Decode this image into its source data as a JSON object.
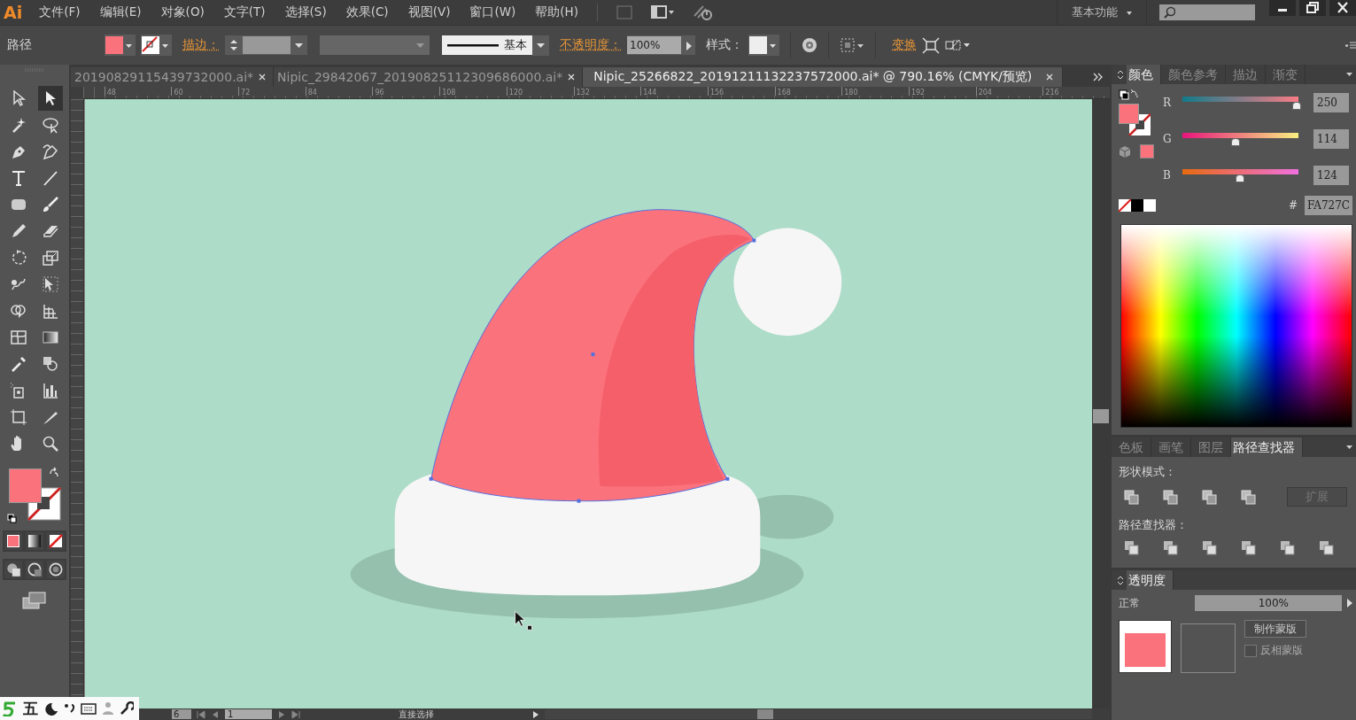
{
  "menu_bar": {
    "logo": "Ai",
    "items": [
      "文件(F)",
      "编辑(E)",
      "对象(O)",
      "文字(T)",
      "选择(S)",
      "效果(C)",
      "视图(V)",
      "窗口(W)",
      "帮助(H)"
    ],
    "workspace": "基本功能"
  },
  "control_bar": {
    "selection": "路径",
    "stroke_label": "描边：",
    "stroke_profile": "基本",
    "opacity_label": "不透明度：",
    "opacity": "100%",
    "style_label": "样式：",
    "transform": "变换"
  },
  "document_tabs": [
    {
      "title": "20190829115439732000.ai*",
      "selected": false
    },
    {
      "title": "Nipic_29842067_20190825112309686000.ai*",
      "selected": false
    },
    {
      "title": "Nipic_25266822_20191211132237572000.ai* @ 790.16% (CMYK/预览)",
      "selected": true
    }
  ],
  "ruler": {
    "ticks": [
      "48",
      "60",
      "72",
      "84",
      "96",
      "108",
      "120",
      "132",
      "144",
      "156",
      "168",
      "180",
      "192",
      "204",
      "216"
    ]
  },
  "tools": [
    {
      "selected": false
    },
    {
      "selected": true
    },
    {
      "selected": false
    },
    {
      "selected": false
    },
    {
      "selected": false
    },
    {
      "selected": false
    },
    {
      "selected": false
    },
    {
      "selected": false
    },
    {
      "selected": false
    },
    {
      "selected": false
    },
    {
      "selected": false
    },
    {
      "selected": false
    },
    {
      "selected": false
    },
    {
      "selected": false
    },
    {
      "selected": false
    },
    {
      "selected": false
    },
    {
      "selected": false
    },
    {
      "selected": false
    },
    {
      "selected": false
    },
    {
      "selected": false
    },
    {
      "selected": false
    },
    {
      "selected": false
    },
    {
      "selected": false
    },
    {
      "selected": false
    },
    {
      "selected": false
    },
    {
      "selected": false
    },
    {
      "selected": false
    },
    {
      "selected": false
    }
  ],
  "color_panel": {
    "tabs": [
      {
        "label": "颜色",
        "selected": true
      },
      {
        "label": "颜色参考",
        "selected": false
      },
      {
        "label": "描边",
        "selected": false
      },
      {
        "label": "渐变",
        "selected": false
      }
    ],
    "channels": [
      {
        "name": "R",
        "level": 0.98,
        "value": "250"
      },
      {
        "name": "G",
        "level": 0.447,
        "value": "114"
      },
      {
        "name": "B",
        "level": 0.486,
        "value": "124"
      }
    ],
    "hex_label": "#",
    "hex": "FA727C"
  },
  "pathfinder_panel": {
    "tabs": [
      {
        "label": "色板",
        "selected": false
      },
      {
        "label": "画笔",
        "selected": false
      },
      {
        "label": "图层",
        "selected": false
      },
      {
        "label": "路径查找器",
        "selected": true
      }
    ],
    "shape_modes_label": "形状模式：",
    "expand_button": {
      "label": "扩展",
      "disabled": true
    },
    "pathfinders_label": "路径查找器："
  },
  "transparency_panel": {
    "title": "透明度",
    "blend_mode": "正常",
    "opacity": "100%",
    "make_mask": "制作蒙版",
    "invert_mask": {
      "label": "反相蒙版",
      "checked": false
    }
  },
  "status_bar": {
    "zoom": "6",
    "page": "1",
    "tool": "直接选择"
  },
  "ime_bar": {
    "mode": "五"
  }
}
